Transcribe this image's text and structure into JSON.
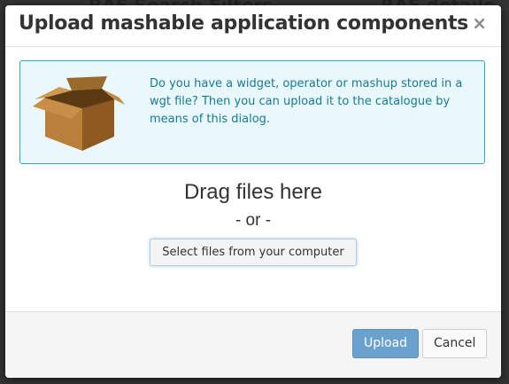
{
  "background": {
    "left_title": "RAF Search Filters",
    "right_title": "RAF details"
  },
  "dialog": {
    "title": "Upload mashable application components",
    "close_symbol": "×",
    "info": {
      "icon": "cardboard-box-icon",
      "text": "Do you have a widget, operator or mashup stored in a wgt file? Then you can upload it to the catalogue by means of this dialog."
    },
    "drop_zone": {
      "drag_label": "Drag files here",
      "or_label": "- or -",
      "select_button": "Select files from your computer"
    },
    "footer": {
      "upload_button": "Upload",
      "cancel_button": "Cancel"
    }
  },
  "colors": {
    "info_border": "#24b3c6",
    "info_bg": "#e9f8fc",
    "info_text": "#177a93",
    "primary": "#6aa1cf"
  }
}
